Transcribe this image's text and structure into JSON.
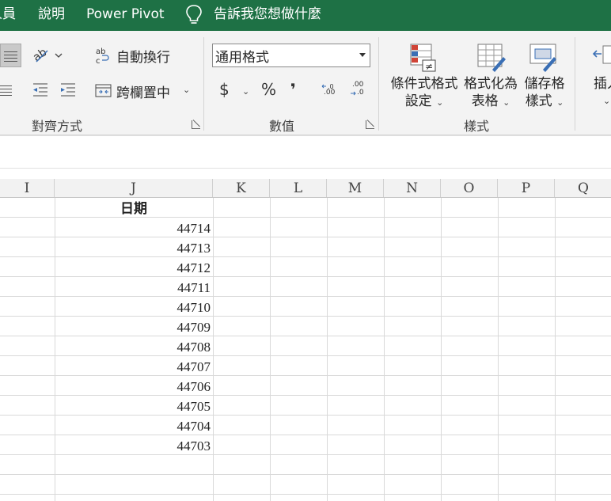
{
  "menu": {
    "partial_item": "人員",
    "item_explain": "說明",
    "item_powerpivot": "Power Pivot",
    "tell_me": "告訴我您想做什麼"
  },
  "ribbon": {
    "alignment": {
      "wrap_text": "自動換行",
      "merge_center": "跨欄置中",
      "group_label": "對齊方式"
    },
    "number": {
      "format_value": "通用格式",
      "currency_symbol": "$",
      "percent_symbol": "%",
      "comma_symbol": "❜",
      "increase_decimal": ".00",
      "decrease_decimal": ".0",
      "group_label": "數值"
    },
    "styles": {
      "conditional_line1": "條件式格式",
      "conditional_line2": "設定",
      "format_table_line1": "格式化為",
      "format_table_line2": "表格",
      "cell_styles_line1": "儲存格",
      "cell_styles_line2": "樣式",
      "group_label": "樣式"
    },
    "cells": {
      "insert_partial": "插入"
    }
  },
  "sheet": {
    "columns": [
      "I",
      "J",
      "K",
      "L",
      "M",
      "N",
      "O",
      "P",
      "Q"
    ],
    "header_cell": "日期",
    "values": [
      44714,
      44713,
      44712,
      44711,
      44710,
      44709,
      44708,
      44707,
      44706,
      44705,
      44704,
      44703
    ]
  },
  "colors": {
    "menubar": "#1e7145",
    "ribbon": "#f3f3f3",
    "gridline": "#d9d9d9"
  }
}
